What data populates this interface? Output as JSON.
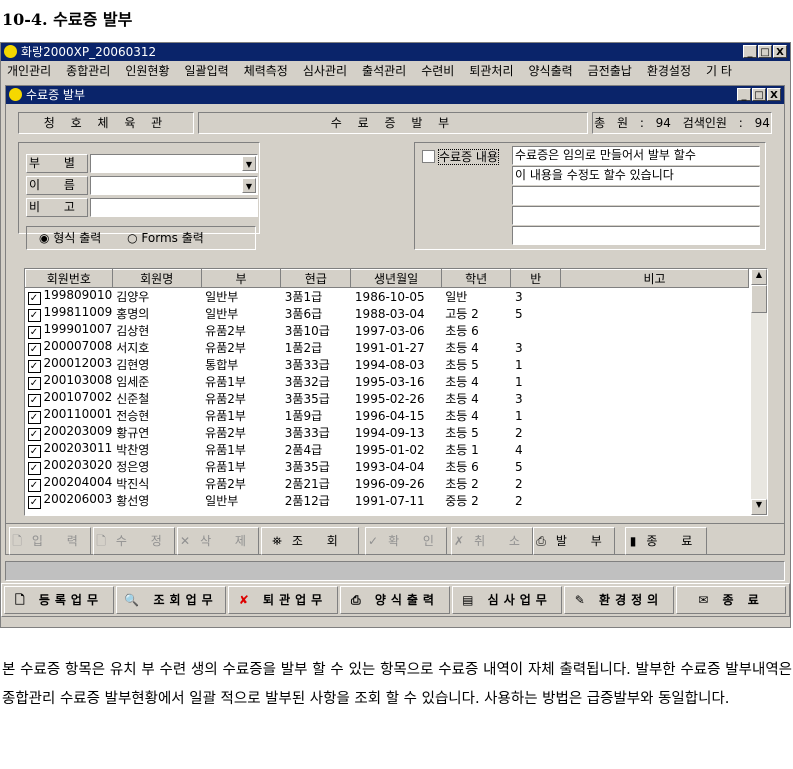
{
  "heading": "10-4. 수료증 발부",
  "app": {
    "title": "화랑2000XP_20060312",
    "minimize": "_",
    "maximize": "□",
    "close": "X"
  },
  "menu": [
    "개인관리",
    "종합관리",
    "인원현황",
    "일괄입력",
    "체력측정",
    "심사관리",
    "출석관리",
    "수련비",
    "퇴관처리",
    "양식출력",
    "금전출납",
    "환경설정",
    "기 타"
  ],
  "child": {
    "title": "수료증 발부",
    "gym": "청 호 체 육 관",
    "form_title": "수 료 증 발 부",
    "total": "총 원 : 94",
    "search_count": "검색인원 : 94"
  },
  "filters": {
    "dept_label": "부 별",
    "dept_value": "",
    "name_label": "이 름",
    "name_value": "",
    "note_label": "비 고",
    "note_value": "",
    "radio1": "형식 출력",
    "radio2": "Forms 출력",
    "radio_selected": "형식 출력"
  },
  "certificate": {
    "checkbox_label": "수료증 내용",
    "checked": false,
    "lines": [
      "수료증은 임의로 만들어서 발부 할수",
      "이 내용을 수정도 할수 있습니다",
      "",
      "",
      ""
    ]
  },
  "table": {
    "columns": [
      "회원번호",
      "회원명",
      "부",
      "현급",
      "생년월일",
      "학년",
      "반",
      "비고"
    ],
    "rows": [
      [
        "199809010",
        "김양우",
        "일반부",
        "3품1급",
        "1986-10-05",
        "일반",
        "3",
        ""
      ],
      [
        "199811009",
        "홍명의",
        "일반부",
        "3품6급",
        "1988-03-04",
        "고등 2",
        "5",
        ""
      ],
      [
        "199901007",
        "김상현",
        "유품2부",
        "3품10급",
        "1997-03-06",
        "초등 6",
        "",
        ""
      ],
      [
        "200007008",
        "서지호",
        "유품2부",
        "1품2급",
        "1991-01-27",
        "초등 4",
        "3",
        ""
      ],
      [
        "200012003",
        "김현영",
        "통합부",
        "3품33급",
        "1994-08-03",
        "초등 5",
        "1",
        ""
      ],
      [
        "200103008",
        "임세준",
        "유품1부",
        "3품32급",
        "1995-03-16",
        "초등 4",
        "1",
        ""
      ],
      [
        "200107002",
        "신준철",
        "유품2부",
        "3품35급",
        "1995-02-26",
        "초등 4",
        "3",
        ""
      ],
      [
        "200110001",
        "전승현",
        "유품1부",
        "1품9급",
        "1996-04-15",
        "초등 4",
        "1",
        ""
      ],
      [
        "200203009",
        "황규연",
        "유품2부",
        "3품33급",
        "1994-09-13",
        "초등 5",
        "2",
        ""
      ],
      [
        "200203011",
        "박찬영",
        "유품1부",
        "2품4급",
        "1995-01-02",
        "초등 1",
        "4",
        ""
      ],
      [
        "200203020",
        "정은영",
        "유품1부",
        "3품35급",
        "1993-04-04",
        "초등 6",
        "5",
        ""
      ],
      [
        "200204004",
        "박진식",
        "유품2부",
        "2품21급",
        "1996-09-26",
        "초등 2",
        "2",
        ""
      ],
      [
        "200206003",
        "황선영",
        "일반부",
        "2품12급",
        "1991-07-11",
        "중등 2",
        "2",
        ""
      ]
    ]
  },
  "toolbar": [
    {
      "label": "입 력",
      "icon": "document-icon",
      "enabled": false
    },
    {
      "label": "수 정",
      "icon": "edit-document-icon",
      "enabled": false
    },
    {
      "label": "삭 제",
      "icon": "x-icon",
      "enabled": false
    },
    {
      "label": "조 회",
      "icon": "binoculars-icon",
      "enabled": true
    },
    {
      "label": "확 인",
      "icon": "check-icon",
      "enabled": false
    },
    {
      "label": "취 소",
      "icon": "cancel-icon",
      "enabled": false
    },
    {
      "label": "발 부",
      "icon": "printer-icon",
      "enabled": true
    },
    {
      "label": "종 료",
      "icon": "exit-door-icon",
      "enabled": true
    }
  ],
  "bottombar": [
    {
      "label": "등록업무",
      "icon": "document-icon"
    },
    {
      "label": "조회업무",
      "icon": "magnifier-icon"
    },
    {
      "label": "퇴관업무",
      "icon": "red-x-icon"
    },
    {
      "label": "양식출력",
      "icon": "printer-icon"
    },
    {
      "label": "심사업무",
      "icon": "form-icon"
    },
    {
      "label": "환경정의",
      "icon": "settings-person-icon"
    },
    {
      "label": "종 료",
      "icon": "exit-icon"
    }
  ],
  "paragraph": "본 수료증 항목은 유치 부 수련 생의 수료증을 발부 할 수 있는 항목으로 수료증 내역이 자체 출력됩니다. 발부한 수료증 발부내역은 종합관리 수료증 발부현황에서 일괄 적으로 발부된 사항을 조회 할 수 있습니다. 사용하는 방법은 급증발부와 동일합니다."
}
